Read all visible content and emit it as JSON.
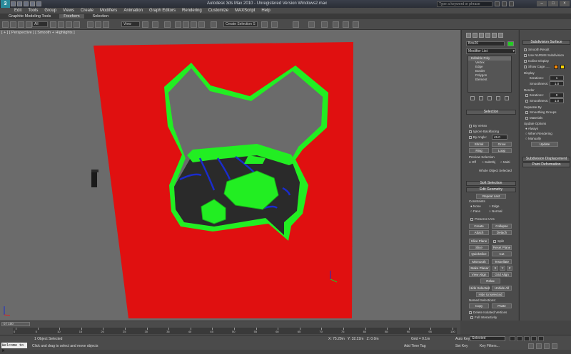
{
  "titlebar": {
    "title": "Autodesk 3ds Max 2010  -  Unregistered Version    Windows2.max",
    "search_placeholder": "Type a keyword or phrase"
  },
  "menu": [
    "Edit",
    "Tools",
    "Group",
    "Views",
    "Create",
    "Modifiers",
    "Animation",
    "Graph Editors",
    "Rendering",
    "Customize",
    "MAXScript",
    "Help"
  ],
  "ribbon": {
    "tabs": [
      "Graphite Modeling Tools",
      "Freeform",
      "Selection"
    ]
  },
  "toolbar": {
    "filter_value": "All",
    "ref_coord": "View",
    "named_sel": "Create Selection S"
  },
  "viewport": {
    "label": "[ + ] [ Perspective ] [ Smooth + Highlights ]",
    "colors": {
      "background": "#6b6b6b",
      "wall": "#e01010",
      "frame": "#22ee22",
      "rod": "#1a2ccc"
    }
  },
  "command_panel": {
    "object_name": "Box20",
    "modifier_list": "Modifier List",
    "stack": [
      "Editable Poly",
      "Vertex",
      "Edge",
      "Border",
      "Polygon",
      "Element"
    ],
    "selection": {
      "header": "Selection",
      "by_vertex": "By Vertex",
      "ignore_backfacing": "Ignore Backfacing",
      "by_angle": "By Angle:",
      "angle_value": "45.0",
      "shrink": "Shrink",
      "grow": "Grow",
      "ring": "Ring",
      "loop": "Loop",
      "preview_selection": "Preview Selection",
      "off": "Off",
      "subobj": "SubObj",
      "multi": "Multi",
      "status": "Whole Object Selected"
    },
    "soft_selection": "Soft Selection",
    "edit_geometry": {
      "header": "Edit Geometry",
      "repeat_last": "Repeat Last",
      "constraints": "Constraints",
      "none": "None",
      "edge": "Edge",
      "face": "Face",
      "normal": "Normal",
      "preserve_uvs": "Preserve UVs",
      "create": "Create",
      "collapse": "Collapse",
      "attach": "Attach",
      "detach": "Detach",
      "slice_plane": "Slice Plane",
      "split": "Split",
      "slice": "Slice",
      "reset_plane": "Reset Plane",
      "quickslice": "QuickSlice",
      "cut": "Cut",
      "msmooth": "MSmooth",
      "tessellate": "Tessellate",
      "make_planar": "Make Planar",
      "x": "X",
      "y": "Y",
      "z": "Z",
      "view_align": "View Align",
      "grid_align": "Grid Align",
      "relax": "Relax",
      "hide_selected": "Hide Selected",
      "unhide_all": "Unhide All",
      "hide_unselected": "Hide Unselected",
      "named_selections": "Named Selections:",
      "copy": "Copy",
      "paste": "Paste",
      "delete_isolated": "Delete Isolated Vertices",
      "full_interactivity": "Full Interactivity"
    }
  },
  "subdivision": {
    "header": "Subdivision Surface",
    "smooth_result": "Smooth Result",
    "use_nurms": "Use NURMS Subdivision",
    "isoline": "Isoline Display",
    "show_cage": "Show Cage......",
    "display": "Display",
    "iterations": "Iterations:",
    "iter_value": "1",
    "smoothness": "Smoothness:",
    "smooth_value": "1.0",
    "render": "Render",
    "r_iterations": "Iterations:",
    "r_iter_value": "0",
    "r_smoothness": "Smoothness:",
    "r_smooth_value": "1.0",
    "separate_by": "Separate By",
    "smoothing_groups": "Smoothing Groups",
    "materials": "Materials",
    "update_options": "Update Options",
    "always": "Always",
    "when_rendering": "When Rendering",
    "manually": "Manually",
    "update": "Update",
    "subdiv_displacement": "Subdivision Displacement",
    "paint_deformation": "Paint Deformation",
    "cage_colors": [
      "#ff8800",
      "#ffd400"
    ]
  },
  "timeline": {
    "slider": "0 / 100",
    "ticks": [
      "0",
      "5",
      "10",
      "15",
      "20",
      "25",
      "30",
      "35",
      "40",
      "45",
      "50",
      "55",
      "60",
      "65",
      "70",
      "75",
      "80",
      "85",
      "90",
      "95",
      "100"
    ]
  },
  "status": {
    "maxscript": "Welcome to M",
    "objects": "1 Object Selected",
    "prompt": "Click and drag to select and move objects",
    "x": "X: 75.29m",
    "y": "Y: 32.22m",
    "z": "Z: 0.0m",
    "grid": "Grid = 0.1m",
    "auto_key": "Auto Key",
    "selected": "Selected",
    "set_key": "Set Key",
    "key_filters": "Key Filters...",
    "add_time_tag": "Add Time Tag"
  }
}
